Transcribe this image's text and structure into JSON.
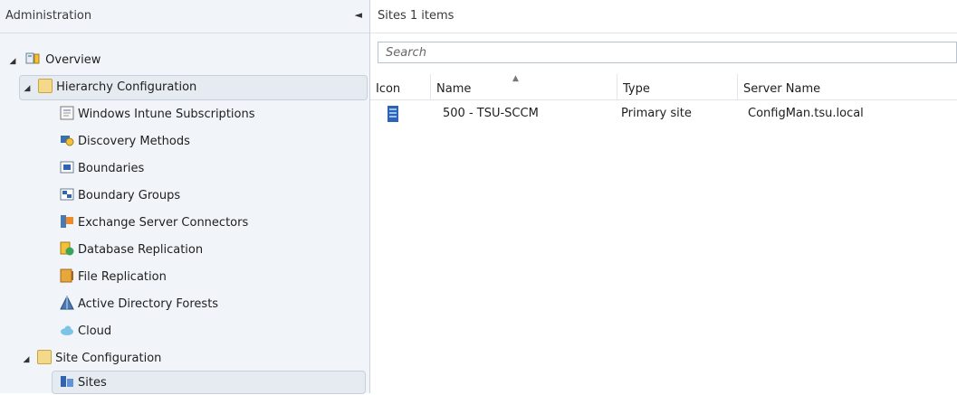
{
  "navigation": {
    "title": "Administration",
    "collapse_glyph": "◄",
    "items": [
      {
        "label": "Overview",
        "icon": "overview-icon",
        "expanded": true
      },
      {
        "label": "Hierarchy Configuration",
        "icon": "folder-icon",
        "expanded": true,
        "selected": true
      },
      {
        "label": "Windows Intune Subscriptions",
        "icon": "intune-subscription-icon"
      },
      {
        "label": "Discovery Methods",
        "icon": "discovery-methods-icon"
      },
      {
        "label": "Boundaries",
        "icon": "boundaries-icon"
      },
      {
        "label": "Boundary Groups",
        "icon": "boundary-groups-icon"
      },
      {
        "label": "Exchange Server Connectors",
        "icon": "exchange-connector-icon"
      },
      {
        "label": "Database Replication",
        "icon": "database-replication-icon"
      },
      {
        "label": "File Replication",
        "icon": "file-replication-icon"
      },
      {
        "label": "Active Directory Forests",
        "icon": "ad-forest-icon"
      },
      {
        "label": "Cloud",
        "icon": "cloud-icon"
      },
      {
        "label": "Site Configuration",
        "icon": "folder-icon",
        "expanded": true
      },
      {
        "label": "Sites",
        "icon": "sites-icon",
        "selected": true
      }
    ]
  },
  "content": {
    "title": "Sites 1 items",
    "search_placeholder": "Search",
    "columns": [
      "Icon",
      "Name",
      "Type",
      "Server Name"
    ],
    "rows": [
      {
        "icon": "site-server-icon",
        "name": "500 - TSU-SCCM",
        "type": "Primary site",
        "server": "ConfigMan.tsu.local"
      }
    ]
  },
  "colors": {
    "nav_background": "#f1f5fa",
    "selection_background": "#e6ebf1",
    "selection_border": "#c6cfdb",
    "folder": "#f4d98a"
  }
}
